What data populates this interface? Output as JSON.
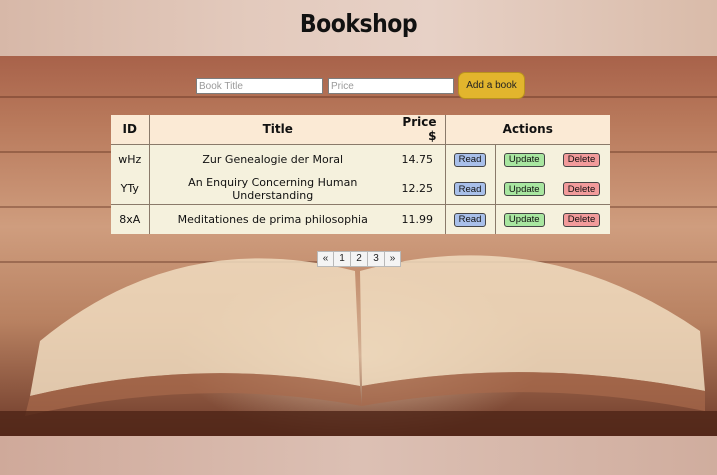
{
  "header": {
    "title": "Bookshop"
  },
  "add_form": {
    "title_placeholder": "Book Title",
    "price_placeholder": "Price",
    "submit_label": "Add a book",
    "submit_color": "#e2b52d"
  },
  "table": {
    "columns": {
      "id": "ID",
      "title": "Title",
      "price": "Price $",
      "actions": "Actions"
    },
    "rows": [
      {
        "id": "wHz",
        "title": "Zur Genealogie der Moral",
        "price": "14.75"
      },
      {
        "id": "YTy",
        "title": "An Enquiry Concerning Human Understanding",
        "price": "12.25"
      },
      {
        "id": "8xA",
        "title": "Meditationes de prima philosophia",
        "price": "11.99"
      }
    ],
    "action_labels": {
      "read": "Read",
      "update": "Update",
      "delete": "Delete"
    },
    "action_colors": {
      "read": "#a9c0ea",
      "update": "#a8e6a0",
      "delete": "#f29b9b"
    }
  },
  "pagination": {
    "prev": "«",
    "pages": [
      "1",
      "2",
      "3"
    ],
    "next": "»"
  }
}
